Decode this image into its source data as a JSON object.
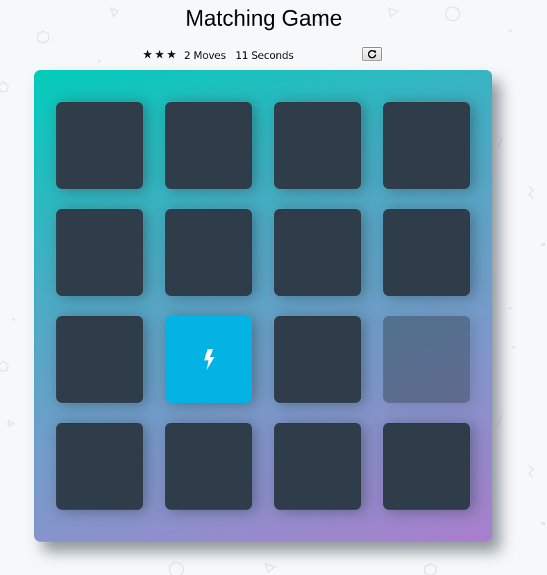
{
  "title": "Matching Game",
  "score": {
    "stars": [
      "★",
      "★",
      "★"
    ],
    "moves_text": "2 Moves",
    "timer_text": "11 Seconds"
  },
  "restart": {
    "icon": "restart-icon"
  },
  "colors": {
    "card_back": "#2e3d49",
    "card_open": "#02b3e4",
    "deck_gradient_start": "#02ccba",
    "deck_gradient_end": "#aa7ecd"
  },
  "deck": {
    "rows": 4,
    "columns": 4,
    "cards": [
      {
        "state": "closed"
      },
      {
        "state": "closed"
      },
      {
        "state": "closed"
      },
      {
        "state": "closed"
      },
      {
        "state": "closed"
      },
      {
        "state": "closed"
      },
      {
        "state": "closed"
      },
      {
        "state": "closed"
      },
      {
        "state": "closed"
      },
      {
        "state": "open",
        "icon": "bolt-icon"
      },
      {
        "state": "closed"
      },
      {
        "state": "faded"
      },
      {
        "state": "closed"
      },
      {
        "state": "closed"
      },
      {
        "state": "closed"
      },
      {
        "state": "closed"
      }
    ]
  }
}
